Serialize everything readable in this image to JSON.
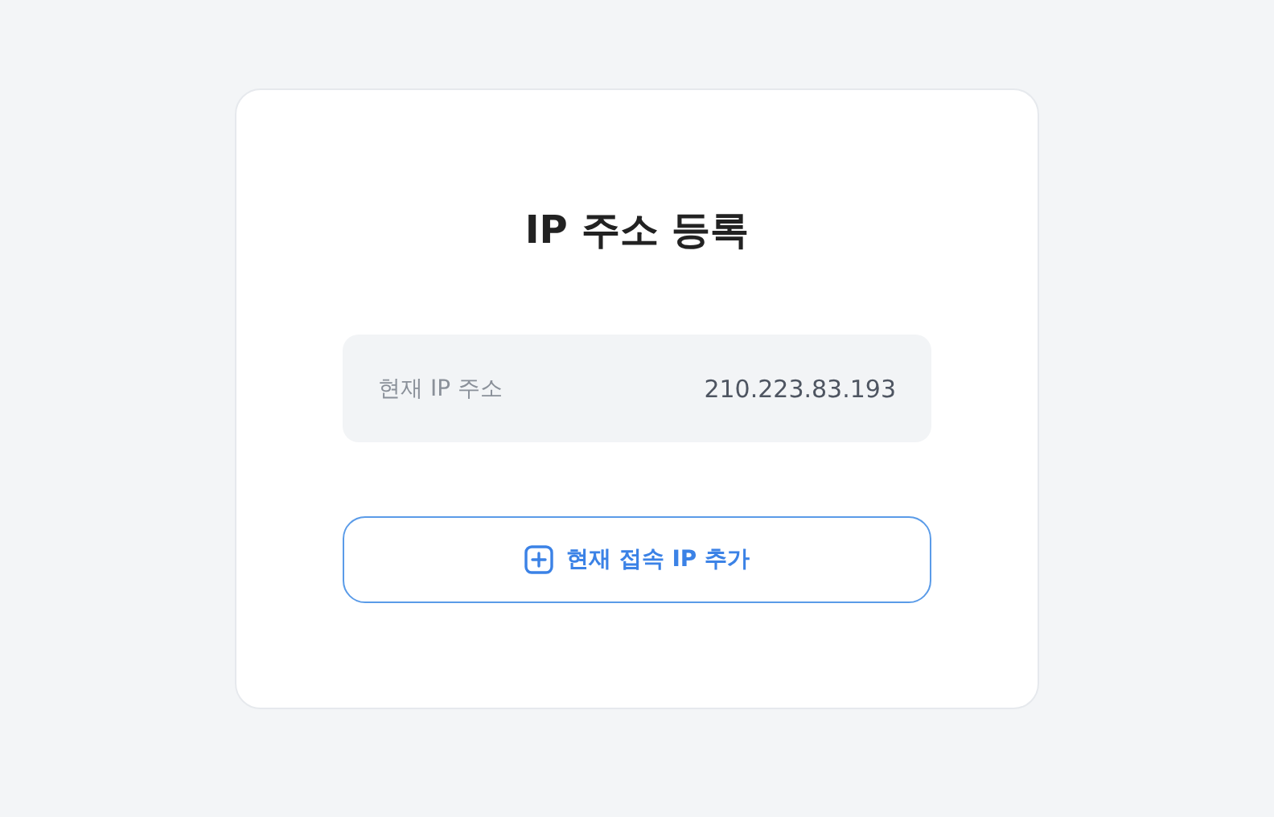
{
  "title": "IP 주소 등록",
  "current_ip": {
    "label": "현재 IP 주소",
    "value": "210.223.83.193"
  },
  "add_button": {
    "label": "현재 접속 IP 추가"
  }
}
